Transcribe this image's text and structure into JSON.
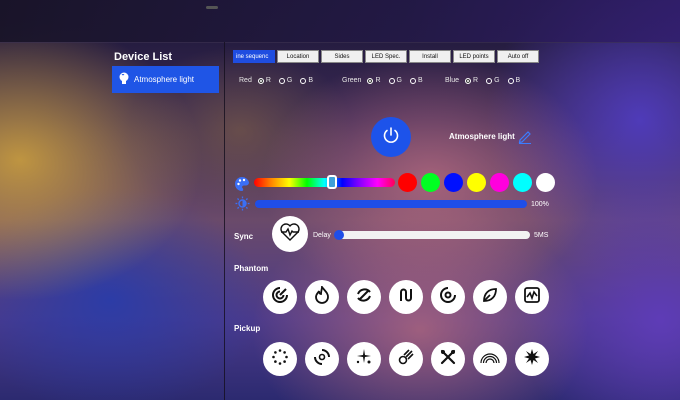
{
  "sidebar": {
    "title": "Device List",
    "devices": [
      {
        "label": "Atmosphere light",
        "icon": "bulb-icon"
      }
    ]
  },
  "tabs": [
    {
      "label": "ine sequenc",
      "active": true
    },
    {
      "label": "Location"
    },
    {
      "label": "Sides"
    },
    {
      "label": "LED Spec."
    },
    {
      "label": "Install"
    },
    {
      "label": "LED points"
    },
    {
      "label": "Auto off"
    }
  ],
  "channels": [
    {
      "label": "Red",
      "options": [
        "R",
        "G",
        "B"
      ],
      "selected": "R"
    },
    {
      "label": "Green",
      "options": [
        "R",
        "G",
        "B"
      ],
      "selected": "R"
    },
    {
      "label": "Blue",
      "options": [
        "R",
        "G",
        "B"
      ],
      "selected": "R"
    }
  ],
  "device_name": "Atmosphere light",
  "color": {
    "swatches": [
      "#ff0000",
      "#00ff22",
      "#0010ff",
      "#ffff00",
      "#ff00dd",
      "#00ffff",
      "#ffffff"
    ],
    "hue_position": 0.55
  },
  "brightness": {
    "value": "100%",
    "level": 1.0
  },
  "sync": {
    "label": "Sync",
    "delay_label": "Delay",
    "delay_value": "5MS",
    "delay_level": 0.0
  },
  "phantom": {
    "label": "Phantom",
    "effects": [
      "target-icon",
      "flame-icon",
      "cycle-icon",
      "wave-icon",
      "vinyl-icon",
      "leaf-icon",
      "chart-wave-icon"
    ]
  },
  "pickup": {
    "label": "Pickup",
    "effects": [
      "dots-circle-icon",
      "spin-icon",
      "sparkle-icon",
      "meteor-icon",
      "cross-icon",
      "rainbow-icon",
      "burst-icon"
    ]
  },
  "accent": "#1f4ee8"
}
